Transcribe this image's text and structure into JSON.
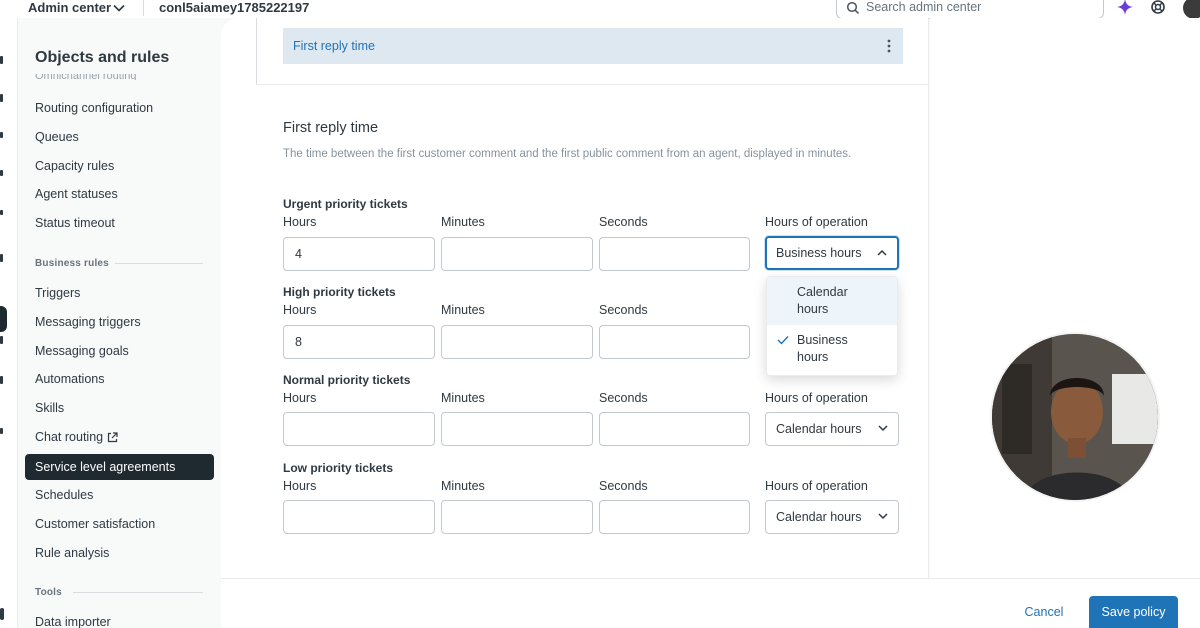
{
  "topbar": {
    "product": "Admin center",
    "account": "conl5aiamey1785222197",
    "search_placeholder": "Search admin center"
  },
  "sidebar": {
    "title": "Objects and rules",
    "cut_item": "Omnichannel routing",
    "items_a": [
      {
        "label": "Routing configuration"
      },
      {
        "label": "Queues"
      },
      {
        "label": "Capacity rules"
      },
      {
        "label": "Agent statuses"
      },
      {
        "label": "Status timeout"
      }
    ],
    "section_business": "Business rules",
    "items_b": [
      {
        "label": "Triggers"
      },
      {
        "label": "Messaging triggers"
      },
      {
        "label": "Messaging goals"
      },
      {
        "label": "Automations"
      },
      {
        "label": "Skills"
      },
      {
        "label": "Chat routing"
      },
      {
        "label": "Service level agreements",
        "selected": true
      },
      {
        "label": "Schedules"
      },
      {
        "label": "Customer satisfaction"
      },
      {
        "label": "Rule analysis"
      }
    ],
    "section_tools": "Tools",
    "items_c": [
      {
        "label": "Data importer"
      }
    ]
  },
  "banner": {
    "label": "First reply time"
  },
  "form": {
    "title": "First reply time",
    "description": "The time between the first customer comment and the first public comment from an agent, displayed in minutes.",
    "labels": {
      "hours": "Hours",
      "minutes": "Minutes",
      "seconds": "Seconds",
      "operation": "Hours of operation"
    },
    "groups": [
      {
        "title": "Urgent priority tickets",
        "hours": "4",
        "minutes": "",
        "seconds": "",
        "operation": "Business hours",
        "open": true
      },
      {
        "title": "High priority tickets",
        "hours": "8",
        "minutes": "",
        "seconds": "",
        "operation": ""
      },
      {
        "title": "Normal priority tickets",
        "hours": "",
        "minutes": "",
        "seconds": "",
        "operation": "Calendar hours"
      },
      {
        "title": "Low priority tickets",
        "hours": "",
        "minutes": "",
        "seconds": "",
        "operation": "Calendar hours"
      }
    ],
    "dropdown_options": [
      {
        "label1": "Calendar",
        "label2": "hours",
        "checked": false
      },
      {
        "label1": "Business",
        "label2": "hours",
        "checked": true
      }
    ]
  },
  "footer": {
    "cancel": "Cancel",
    "save": "Save policy"
  },
  "colors": {
    "accent": "#1f73b7",
    "selected_nav": "#1f2a30",
    "banner_bg": "#dde8f0"
  }
}
